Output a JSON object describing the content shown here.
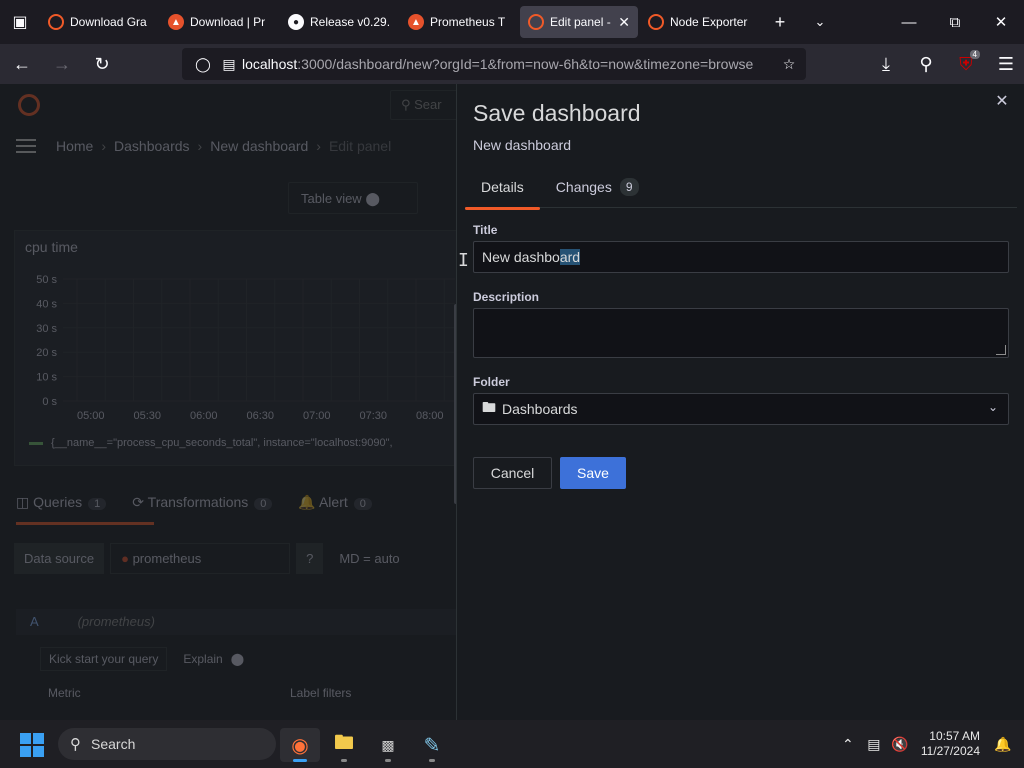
{
  "browser": {
    "tabs": [
      {
        "label": "Download Gra",
        "icon": "grafana-icon",
        "active": false
      },
      {
        "label": "Download | Pr",
        "icon": "prometheus-icon",
        "active": false
      },
      {
        "label": "Release v0.29.",
        "icon": "github-icon",
        "active": false
      },
      {
        "label": "Prometheus T",
        "icon": "prometheus-icon",
        "active": false
      },
      {
        "label": "Edit panel -",
        "icon": "grafana-icon",
        "active": true
      },
      {
        "label": "Node Exporter",
        "icon": "grafana-icon",
        "active": false
      }
    ],
    "url_host": "localhost",
    "url_path": ":3000/dashboard/new?orgId=1&from=now-6h&to=now&timezone=browse",
    "extension_badge": "4"
  },
  "grafana": {
    "search_placeholder": "Sear",
    "breadcrumbs": [
      "Home",
      "Dashboards",
      "New dashboard",
      "Edit panel"
    ],
    "table_view_label": "Table view",
    "panel": {
      "title": "cpu time",
      "legend": "{__name__=\"process_cpu_seconds_total\", instance=\"localhost:9090\","
    },
    "chart_data": {
      "type": "line",
      "title": "cpu time",
      "y_ticks": [
        "50 s",
        "40 s",
        "30 s",
        "20 s",
        "10 s",
        "0 s"
      ],
      "x_ticks": [
        "05:00",
        "05:30",
        "06:00",
        "06:30",
        "07:00",
        "07:30",
        "08:00"
      ],
      "ylim": [
        0,
        50
      ]
    },
    "query_tabs": [
      {
        "label": "Queries",
        "count": "1"
      },
      {
        "label": "Transformations",
        "count": "0"
      },
      {
        "label": "Alert",
        "count": "0"
      }
    ],
    "data_source_label": "Data source",
    "data_source_value": "prometheus",
    "query_options": "MD = auto",
    "query_letter": "A",
    "query_source": "(prometheus)",
    "kick_start_label": "Kick start your query",
    "explain_label": "Explain",
    "metric_label": "Metric",
    "label_filters_label": "Label filters"
  },
  "drawer": {
    "title": "Save dashboard",
    "subtitle": "New dashboard",
    "tabs": [
      {
        "label": "Details",
        "active": true
      },
      {
        "label": "Changes",
        "count": "9",
        "active": false
      }
    ],
    "title_label": "Title",
    "title_value_plain": "New dashbo",
    "title_value_selected": "ard",
    "description_label": "Description",
    "description_value": "",
    "folder_label": "Folder",
    "folder_value": "Dashboards",
    "cancel_label": "Cancel",
    "save_label": "Save"
  },
  "taskbar": {
    "search_label": "Search",
    "time": "10:57 AM",
    "date": "11/27/2024"
  },
  "colors": {
    "accent": "#f05a28",
    "primary_button": "#3d71d9",
    "selection": "#265274"
  }
}
